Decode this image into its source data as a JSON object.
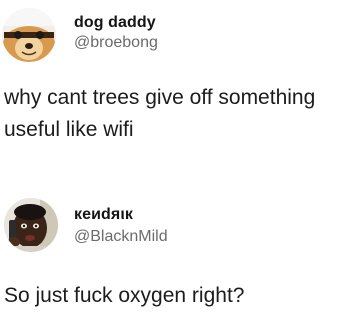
{
  "tweets": [
    {
      "display_name": "dog daddy",
      "handle": "@broebong",
      "text": "why cant trees give off something\nuseful like wifi",
      "avatar_icon": "dog-face-avatar"
    },
    {
      "display_name": "кеиdяιк",
      "handle": "@BlacknMild",
      "text": "So just fuck oxygen right?",
      "avatar_icon": "man-on-phone-avatar"
    }
  ]
}
